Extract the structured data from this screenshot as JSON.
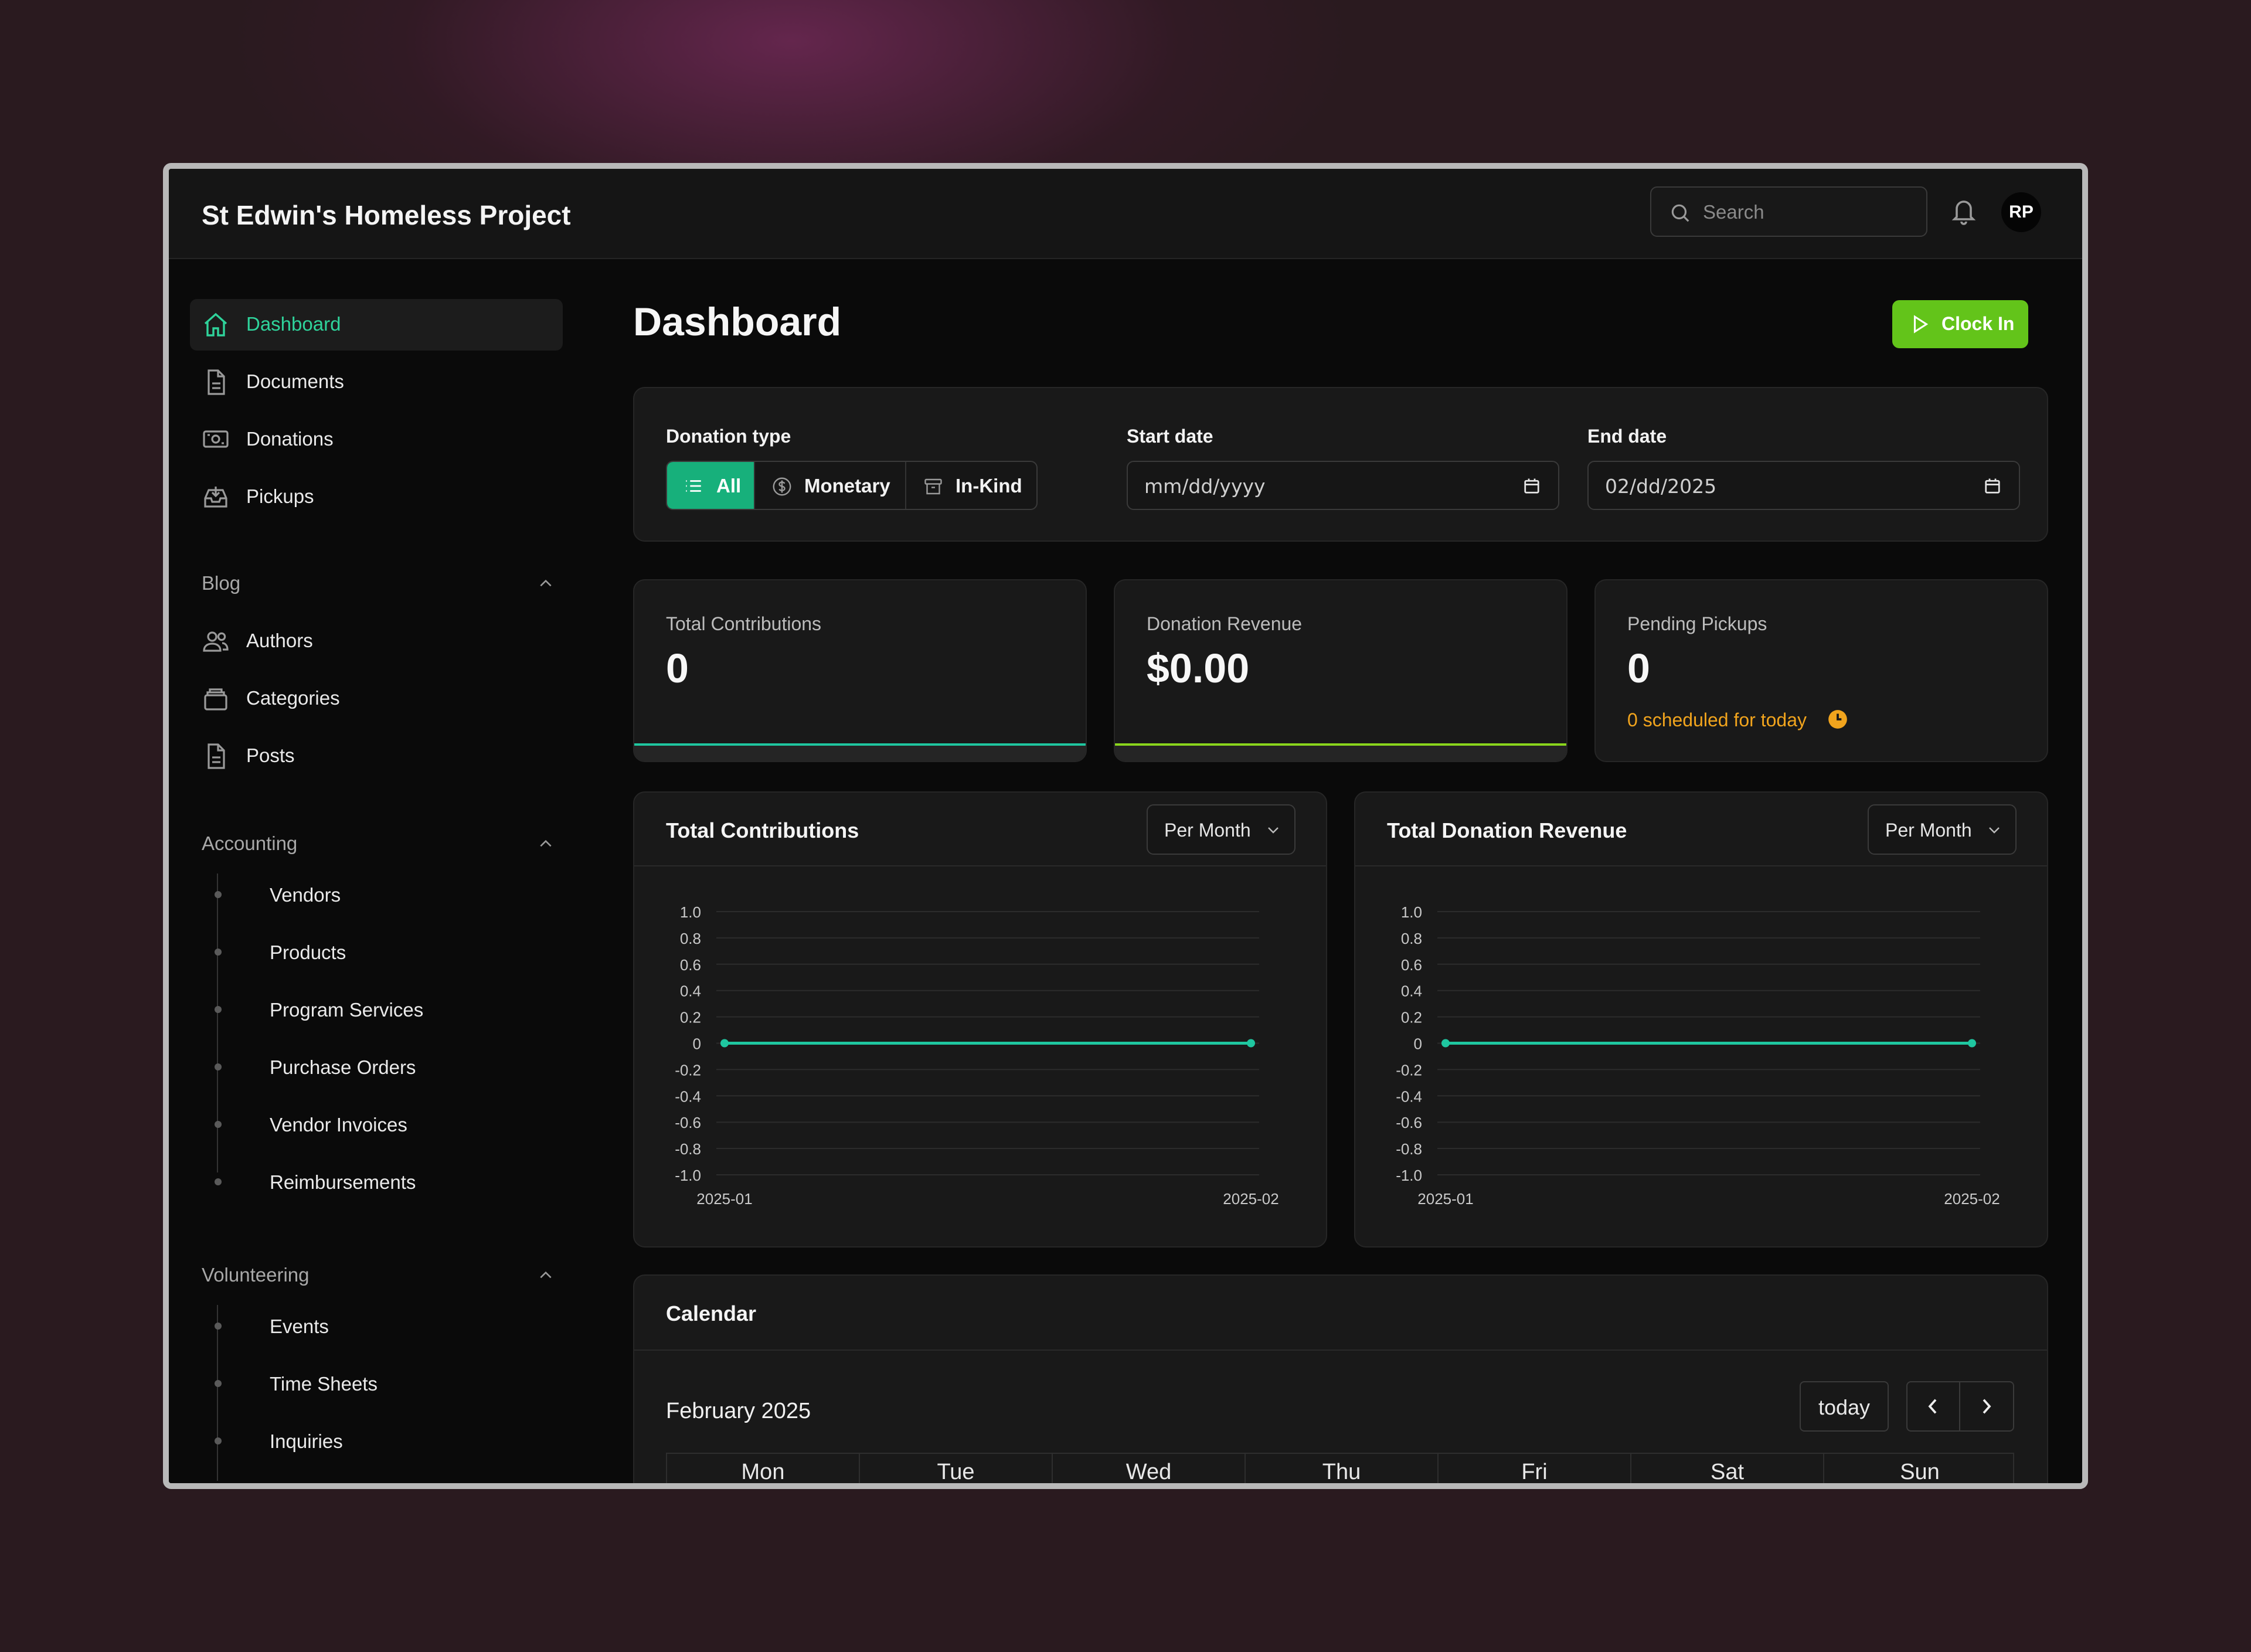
{
  "app": {
    "title": "St Edwin's Homeless Project"
  },
  "header": {
    "search_placeholder": "Search",
    "avatar_initials": "RP"
  },
  "sidebar": {
    "main_items": [
      {
        "label": "Dashboard",
        "icon": "home-icon",
        "active": true
      },
      {
        "label": "Documents",
        "icon": "document-icon"
      },
      {
        "label": "Donations",
        "icon": "cash-icon"
      },
      {
        "label": "Pickups",
        "icon": "inbox-download-icon"
      }
    ],
    "blog": {
      "title": "Blog",
      "items": [
        {
          "label": "Authors",
          "icon": "users-icon"
        },
        {
          "label": "Categories",
          "icon": "folder-stack-icon"
        },
        {
          "label": "Posts",
          "icon": "document-icon"
        }
      ]
    },
    "accounting": {
      "title": "Accounting",
      "items": [
        "Vendors",
        "Products",
        "Program Services",
        "Purchase Orders",
        "Vendor Invoices",
        "Reimbursements"
      ]
    },
    "volunteering": {
      "title": "Volunteering",
      "items": [
        "Events",
        "Time Sheets",
        "Inquiries"
      ]
    }
  },
  "page": {
    "title": "Dashboard",
    "clock_in_label": "Clock In"
  },
  "filters": {
    "donation_type_label": "Donation type",
    "types": [
      "All",
      "Monetary",
      "In-Kind"
    ],
    "selected_type": "All",
    "start_date_label": "Start date",
    "start_date_value": "mm/dd/yyyy",
    "end_date_label": "End date",
    "end_date_value": "02/dd/2025"
  },
  "stats": {
    "total_contributions": {
      "title": "Total Contributions",
      "value": "0",
      "accent": "#1fc7a0"
    },
    "donation_revenue": {
      "title": "Donation Revenue",
      "value": "$0.00",
      "accent": "#8ad61c"
    },
    "pending_pickups": {
      "title": "Pending Pickups",
      "value": "0",
      "note": "0 scheduled for today"
    }
  },
  "chart_data": [
    {
      "type": "line",
      "title": "Total Contributions",
      "period": "Per Month",
      "x": [
        "2025-01",
        "2025-02"
      ],
      "series": [
        {
          "values": [
            0,
            0
          ],
          "color": "#1fc7a0"
        }
      ],
      "ylim": [
        -1.0,
        1.0
      ],
      "yticks": [
        "1.0",
        "0.8",
        "0.6",
        "0.4",
        "0.2",
        "0",
        "-0.2",
        "-0.4",
        "-0.6",
        "-0.8",
        "-1.0"
      ],
      "grid": true
    },
    {
      "type": "line",
      "title": "Total Donation Revenue",
      "period": "Per Month",
      "x": [
        "2025-01",
        "2025-02"
      ],
      "series": [
        {
          "values": [
            0,
            0
          ],
          "color": "#1fc7a0"
        }
      ],
      "ylim": [
        -1.0,
        1.0
      ],
      "yticks": [
        "1.0",
        "0.8",
        "0.6",
        "0.4",
        "0.2",
        "0",
        "-0.2",
        "-0.4",
        "-0.6",
        "-0.8",
        "-1.0"
      ],
      "grid": true
    }
  ],
  "calendar": {
    "title": "Calendar",
    "month_label": "February 2025",
    "today_label": "today",
    "weekdays": [
      "Mon",
      "Tue",
      "Wed",
      "Thu",
      "Fri",
      "Sat",
      "Sun"
    ]
  },
  "colors": {
    "accent_green": "#17b07b",
    "clock_in": "#63c41a",
    "warning": "#f1a41d"
  }
}
